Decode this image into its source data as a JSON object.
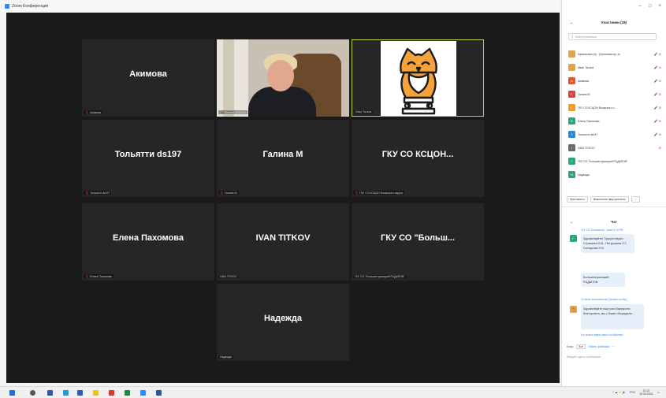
{
  "window": {
    "title": "Zoom Конференция"
  },
  "window_controls": {
    "minimize": "–",
    "maximize": "□",
    "close": "×"
  },
  "tiles": [
    {
      "name": "Акимова",
      "label": "Акимова",
      "muted": true
    },
    {
      "name": "",
      "label": "Евгения Шахова",
      "muted": true
    },
    {
      "name": "",
      "label": "Илья Титков",
      "muted": false
    },
    {
      "name": "Тольятти ds197",
      "label": "Тольятти ds197",
      "muted": true
    },
    {
      "name": "Галина М",
      "label": "Галина М",
      "muted": true
    },
    {
      "name": "ГКУ СО КСЦОН...",
      "label": "ГКУ СО КСЦОН Волжского округа",
      "muted": true
    },
    {
      "name": "Елена Пахомова",
      "label": "Елена Пахомова",
      "muted": true
    },
    {
      "name": "IVAN TITKOV",
      "label": "IVAN TITKOV",
      "muted": false
    },
    {
      "name": "ГКУ СО \"Больш...",
      "label": "ГКУ СО \"Большеглушицкий РЦДиПОВ\"",
      "muted": false
    },
    {
      "name": "Надежда",
      "label": "Надежда",
      "muted": false
    }
  ],
  "participants": {
    "title": "Участники (18)",
    "search_placeholder": "Найти участника",
    "items": [
      {
        "name": "Афанасьев (я) · (Организатор, я)",
        "initial": "",
        "color": "#e0a44a",
        "status": "🎤 ⊘"
      },
      {
        "name": "Иван Титков",
        "initial": "",
        "color": "#e0a44a",
        "status": "🎤 ⊘"
      },
      {
        "name": "Акимова",
        "initial": "A",
        "color": "#e0552b",
        "status": "🎤 ⊘"
      },
      {
        "name": "Галина М",
        "initial": "Г",
        "color": "#e04040",
        "status": "🎤 ⊘"
      },
      {
        "name": "ГКУ СО КСЦОН Волжского о...",
        "initial": "Г",
        "color": "#f0a020",
        "status": "🎤 ⊘"
      },
      {
        "name": "Елена Пахомова",
        "initial": "Е",
        "color": "#2aa876",
        "status": "🎤 ⊘"
      },
      {
        "name": "Тольятти ds197",
        "initial": "Т",
        "color": "#2b8ad8",
        "status": "🎤 ⊘"
      },
      {
        "name": "IVAN TITKOV",
        "initial": "I",
        "color": "#6a6a6a",
        "status": "⊘"
      },
      {
        "name": "ГКУ СО \"Большеглушицкий РЦДиПОВ\"",
        "initial": "Г",
        "color": "#2aa876",
        "status": ""
      },
      {
        "name": "Надежда",
        "initial": "Н",
        "color": "#2aa876",
        "status": ""
      }
    ],
    "invite_label": "Пригласить",
    "mute_all_label": "Выключить звук для всех",
    "more_label": "..."
  },
  "chat": {
    "title": "Чат",
    "msg1_meta": "ГКУ СО \"Большеглу... (мне) 9:15 PM",
    "msg1_initial": "Г",
    "msg1_color": "#2aa876",
    "msg1_text": "Здравствуйте! Присутствуют: Стрыкина М.В., Петрушина Л.Г., Гончарова Н.В.",
    "msg1_text2": "Большеглушицкий РЦДиПОВ",
    "msg2_meta": "От меня пользователю (Личное сообщ.)",
    "msg2_text": "Здравствуйте еще раз Маргарита Викторовна, мы с Вами обсуждали ...",
    "who_can_see": "Кто может видеть ваши сообщения?",
    "to_label": "Кому:",
    "to_value": "Все",
    "file_label": "Обмен файлами",
    "input_placeholder": "Введите здесь сообщение..."
  },
  "taskbar": {
    "lang": "РУС",
    "time": "10:13",
    "date": "16.03.2021"
  },
  "colors": {
    "active_border": "#b6d34a",
    "muted": "#e02828",
    "accent": "#2d8cff",
    "owl": "#f5a23a"
  }
}
